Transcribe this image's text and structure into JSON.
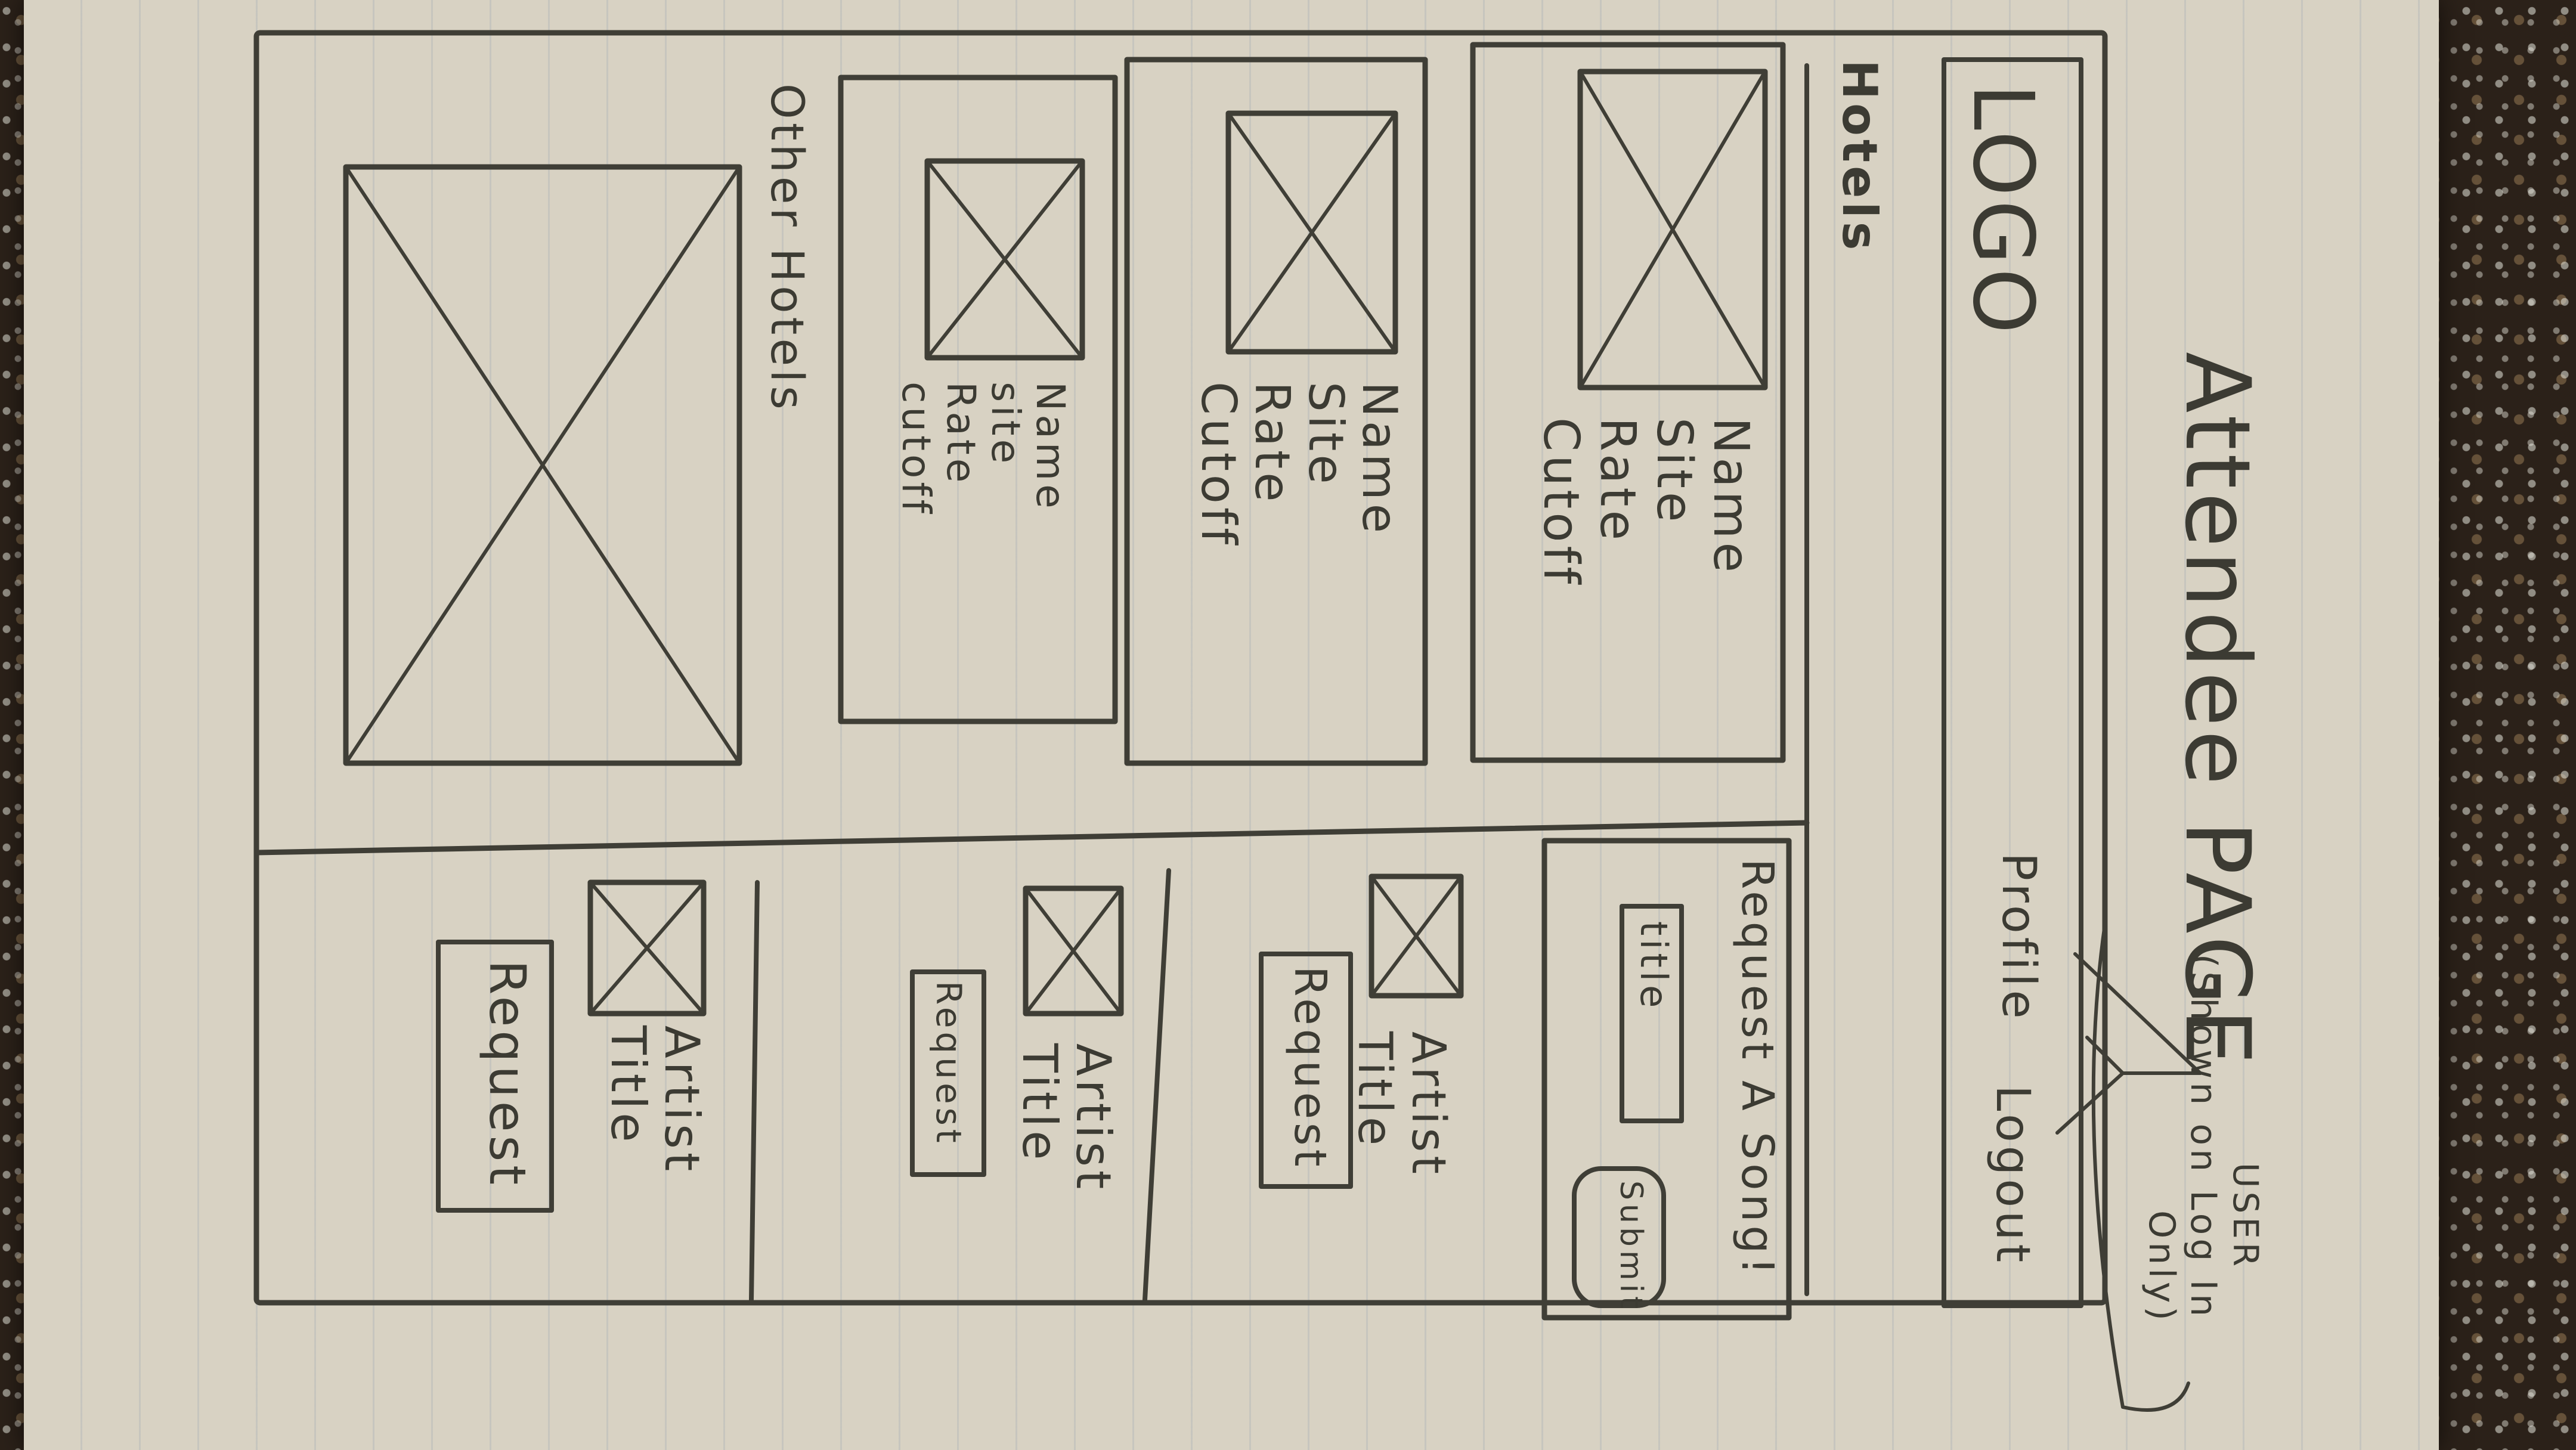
{
  "page_title": "Attendee PAGE",
  "header": {
    "logo": "LOGO",
    "profile_link": "Profile",
    "logout_link": "Logout",
    "note_line1": "USER",
    "note_line2": "(Shown on Log In",
    "note_line3": "Only)"
  },
  "hotels": {
    "heading": "Hotels",
    "cards": [
      {
        "name": "Name",
        "site": "Site",
        "rate": "Rate",
        "cutoff": "Cutoff"
      },
      {
        "name": "Name",
        "site": "Site",
        "rate": "Rate",
        "cutoff": "Cutoff"
      },
      {
        "name": "Name",
        "site": "site",
        "rate": "Rate",
        "cutoff": "cutoff"
      }
    ],
    "other_heading": "Other Hotels"
  },
  "song_request": {
    "heading": "Request A Song!",
    "title_placeholder": "title",
    "submit_label": "Submit"
  },
  "songs": [
    {
      "artist": "Artist",
      "title": "Title",
      "request_label": "Request"
    },
    {
      "artist": "Artist",
      "title": "Title",
      "request_label": "Request"
    },
    {
      "artist": "Artist",
      "title": "Title",
      "request_label": "Request"
    }
  ]
}
